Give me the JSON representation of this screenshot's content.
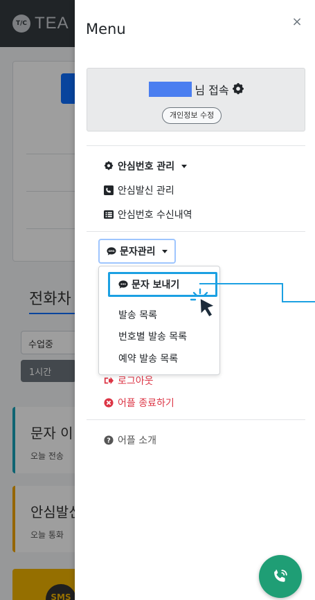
{
  "background": {
    "logo_badge": "T/C",
    "logo_text": "TEA",
    "section_title": "전화차",
    "select_value": "수업중",
    "pill_label": "1시간",
    "card_sms_title": "문자 이",
    "card_sms_sub": "오늘 전송",
    "card_call_title": "안심발신",
    "card_call_sub": "오늘 통화",
    "sms_badge": "SMS"
  },
  "panel": {
    "title": "Menu",
    "close_label": "×",
    "user_suffix": "님 접속",
    "edit_profile": "개인정보 수정"
  },
  "menu": {
    "safe_number_manage": "안심번호 관리",
    "safe_call_manage": "안심발신 관리",
    "safe_number_inbox": "안심번호 수신내역",
    "sms_manage": "문자관리",
    "sms_items": [
      "문자 보내기",
      "발송 목록",
      "번호별 발송 목록",
      "예약 발송 목록"
    ],
    "logout": "로그아웃",
    "quit_app": "어플 종료하기",
    "about_app": "어플 소개"
  },
  "colors": {
    "accent": "#0d6efd",
    "highlight": "#1ba0e2",
    "danger": "#dc3545",
    "fab": "#1f9e75"
  }
}
